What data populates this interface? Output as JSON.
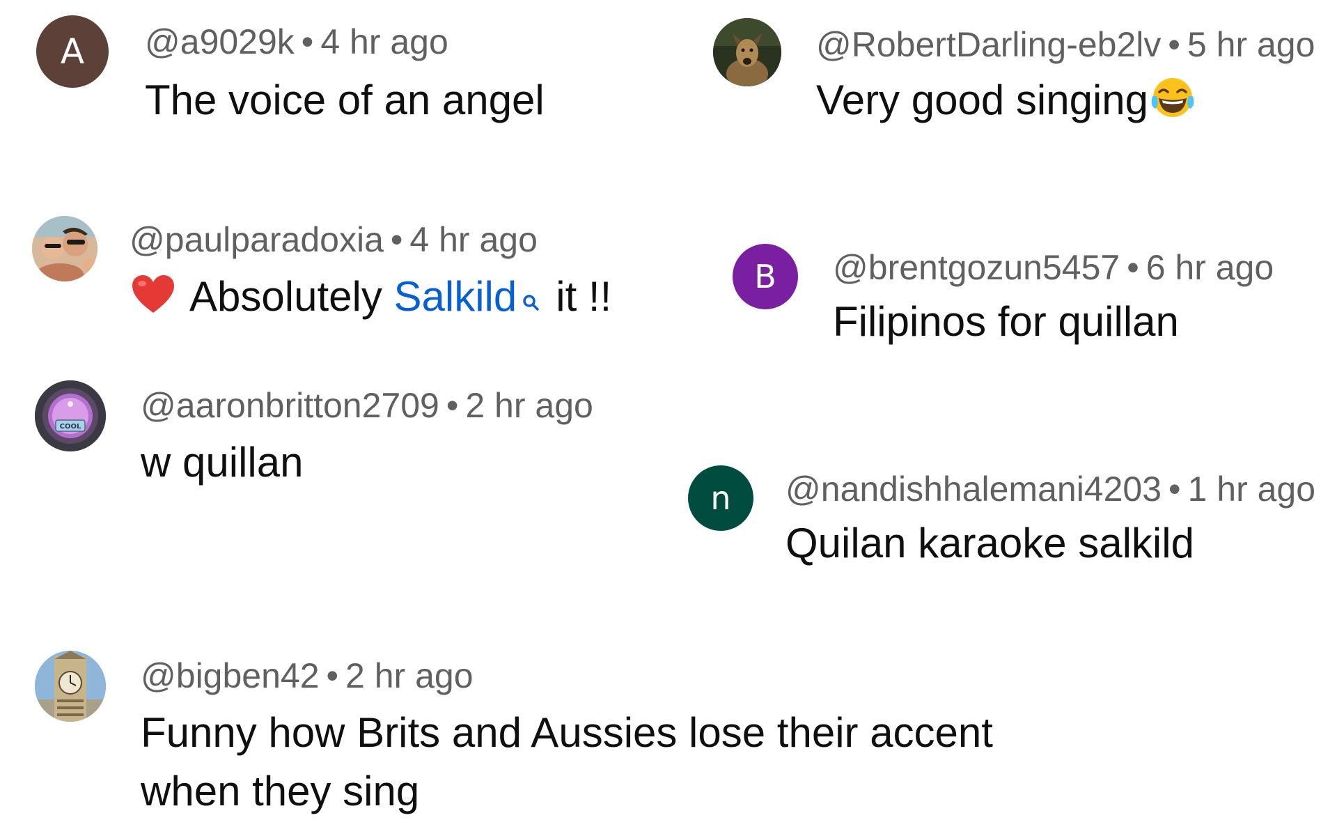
{
  "comments": [
    {
      "handle": "@a9029k",
      "separator": "•",
      "time": "4 hr ago",
      "text": "The voice of an angel",
      "avatar": {
        "type": "letter",
        "letter": "A",
        "color": "#5d4037"
      }
    },
    {
      "handle": "@RobertDarling-eb2lv",
      "separator": "•",
      "time": "5 hr ago",
      "text": "Very good singing",
      "emoji": "face-with-tears-of-joy-icon",
      "avatar": {
        "type": "photo",
        "subject": "dog"
      }
    },
    {
      "handle": "@paulparadoxia",
      "separator": "•",
      "time": "4 hr ago",
      "text_parts": {
        "emoji": "red-heart-icon",
        "before": "Absolutely",
        "link": "Salkild",
        "link_icon": "search-icon",
        "after": "it !!"
      },
      "avatar": {
        "type": "photo",
        "subject": "group-selfie"
      }
    },
    {
      "handle": "@brentgozun5457",
      "separator": "•",
      "time": "6 hr ago",
      "text": "Filipinos for quillan",
      "avatar": {
        "type": "letter",
        "letter": "B",
        "color": "#7b1fa2"
      }
    },
    {
      "handle": "@aaronbritton2709",
      "separator": "•",
      "time": "2 hr ago",
      "text": "w quillan",
      "avatar": {
        "type": "photo",
        "subject": "cool-button",
        "badge": "COOL"
      }
    },
    {
      "handle": "@nandishhalemani4203",
      "separator": "•",
      "time": "1 hr ago",
      "text": "Quilan karaoke salkild",
      "avatar": {
        "type": "letter",
        "letter": "n",
        "color": "#004d40"
      }
    },
    {
      "handle": "@bigben42",
      "separator": "•",
      "time": "2 hr ago",
      "text_line1": "Funny how Brits and Aussies lose their accent",
      "text_line2": "when they sing",
      "avatar": {
        "type": "photo",
        "subject": "big-ben"
      }
    }
  ],
  "colors": {
    "meta": "#606060",
    "text": "#0f0f0f",
    "link": "#065fd4"
  }
}
